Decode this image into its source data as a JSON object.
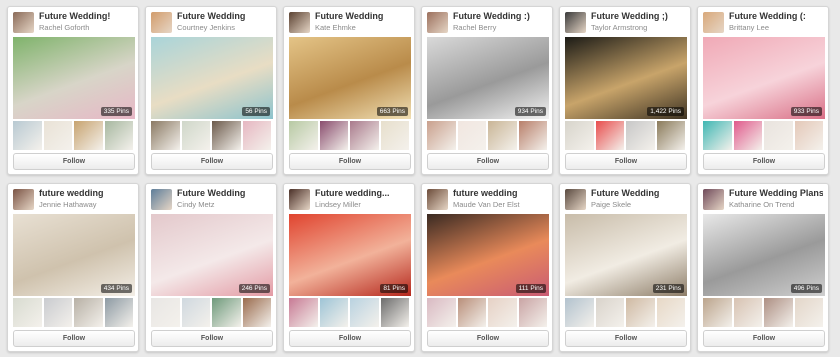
{
  "follow_label": "Follow",
  "boards": [
    {
      "title": "Future Wedding!",
      "owner": "Rachel Goforth",
      "pins": "335 Pins",
      "avatar_color": "#8a6a58",
      "cover_colors": [
        "#7fb36b",
        "#d8d5c8",
        "#e7b7c6"
      ],
      "thumb_colors": [
        "#b8c9d2",
        "#e9e2d6",
        "#c7a36f",
        "#a7b8a0"
      ]
    },
    {
      "title": "Future Wedding",
      "owner": "Courtney Jenkins",
      "pins": "56 Pins",
      "avatar_color": "#d29c6b",
      "cover_colors": [
        "#a9d4d9",
        "#e8ddc4",
        "#8cc3cd"
      ],
      "thumb_colors": [
        "#8b7a64",
        "#cfd7c9",
        "#6c5a4b",
        "#e6b7c1"
      ]
    },
    {
      "title": "Future Wedding",
      "owner": "Kate Ehmke",
      "pins": "663 Pins",
      "avatar_color": "#5b4232",
      "cover_colors": [
        "#e4c487",
        "#b98b4a",
        "#f0dfb4"
      ],
      "thumb_colors": [
        "#b7c9a3",
        "#8a4d6e",
        "#a97a8c",
        "#e7dfcc"
      ]
    },
    {
      "title": "Future Wedding :)",
      "owner": "Rachel Berry",
      "pins": "934 Pins",
      "avatar_color": "#9b6f5c",
      "cover_colors": [
        "#d9d9d9",
        "#9a9a9a",
        "#f2f2f2"
      ],
      "thumb_colors": [
        "#c9a08d",
        "#f1e6e0",
        "#c9b596",
        "#b87f6a"
      ]
    },
    {
      "title": "Future Wedding ;)",
      "owner": "Taylor Armstrong",
      "pins": "1,422 Pins",
      "avatar_color": "#3a3a3a",
      "cover_colors": [
        "#1c1b16",
        "#c8a46a",
        "#3f3424"
      ],
      "thumb_colors": [
        "#d7d4cb",
        "#e84d4d",
        "#c7c7c7",
        "#8a7a5a"
      ]
    },
    {
      "title": "Future Wedding (:",
      "owner": "Brittany Lee",
      "pins": "933 Pins",
      "avatar_color": "#d8a87a",
      "cover_colors": [
        "#f0a9b6",
        "#f7d3da",
        "#d96f86"
      ],
      "thumb_colors": [
        "#3fb7b3",
        "#e05a8c",
        "#e9e3de",
        "#e4c8b8"
      ]
    },
    {
      "title": "future wedding",
      "owner": "Jennie Hathaway",
      "pins": "434 Pins",
      "avatar_color": "#7a5344",
      "cover_colors": [
        "#e8e0d3",
        "#cfc2ad",
        "#f3eee6"
      ],
      "thumb_colors": [
        "#d8dbd0",
        "#c9cbcf",
        "#b7b0a5",
        "#8d9aa3"
      ]
    },
    {
      "title": "Future Wedding",
      "owner": "Cindy Metz",
      "pins": "246 Pins",
      "avatar_color": "#5d7d99",
      "cover_colors": [
        "#e3c8cb",
        "#f4e9e9",
        "#e39aa4"
      ],
      "thumb_colors": [
        "#e8e6e4",
        "#cfd8df",
        "#6e9a7b",
        "#9a6b4d"
      ]
    },
    {
      "title": "Future wedding...",
      "owner": "Lindsey Miller",
      "pins": "81 Pins",
      "avatar_color": "#4a2f27",
      "cover_colors": [
        "#e0442f",
        "#f2b29a",
        "#b5281d"
      ],
      "thumb_colors": [
        "#c77a94",
        "#9ec4d6",
        "#b9d2e0",
        "#6c6c6c"
      ]
    },
    {
      "title": "future wedding",
      "owner": "Maude Van Der Elst",
      "pins": "111 Pins",
      "avatar_color": "#6c4c3a",
      "cover_colors": [
        "#3a2a22",
        "#e98a5a",
        "#c95b74"
      ],
      "thumb_colors": [
        "#d9b9c2",
        "#b98f7a",
        "#e6d1c5",
        "#c9a4a4"
      ]
    },
    {
      "title": "Future Wedding",
      "owner": "Paige Skele",
      "pins": "231 Pins",
      "avatar_color": "#5a4a40",
      "cover_colors": [
        "#c8bca9",
        "#f1ece3",
        "#8d7d68"
      ],
      "thumb_colors": [
        "#b2c2ce",
        "#d9d3cb",
        "#cfb9a2",
        "#e7d8c6"
      ]
    },
    {
      "title": "Future Wedding Plans!",
      "owner": "Katharine On Trend",
      "pins": "496 Pins",
      "avatar_color": "#6f4a5a",
      "cover_colors": [
        "#e8e8e8",
        "#9a9a9a",
        "#cfcfcf"
      ],
      "thumb_colors": [
        "#bba48c",
        "#d7c2b2",
        "#ad8f83",
        "#e3d6c9"
      ]
    }
  ]
}
